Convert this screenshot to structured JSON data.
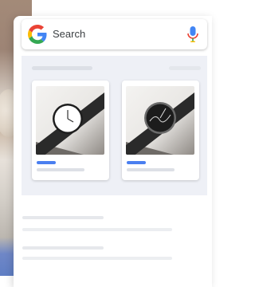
{
  "search": {
    "placeholder": "Search",
    "icons": {
      "logo": "google-g-logo",
      "mic": "mic-icon"
    }
  },
  "products": [
    {
      "name": "watch-product-1",
      "image": "wristwatch-white-dial"
    },
    {
      "name": "watch-product-2",
      "image": "wristwatch-black-dial"
    }
  ],
  "colors": {
    "accent_blue": "#4a7ff0",
    "placeholder_grey": "#dcdfe6",
    "panel_bg": "#eef0f6"
  }
}
